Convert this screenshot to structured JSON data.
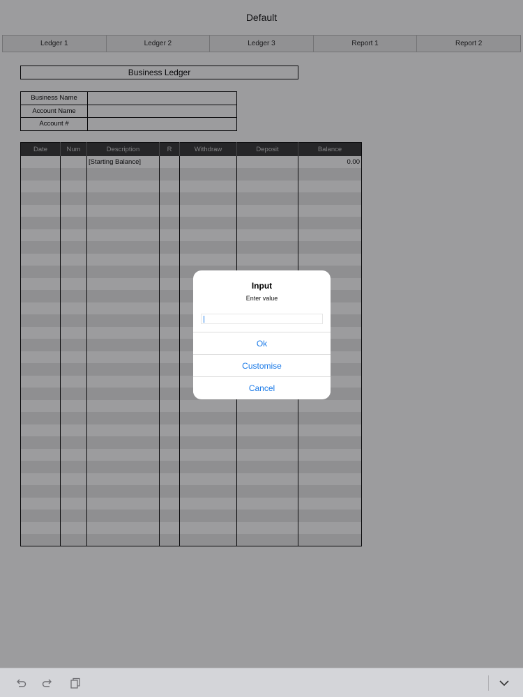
{
  "app": {
    "title": "Default"
  },
  "tabs": [
    {
      "label": "Ledger 1"
    },
    {
      "label": "Ledger 2"
    },
    {
      "label": "Ledger 3"
    },
    {
      "label": "Report 1"
    },
    {
      "label": "Report 2"
    }
  ],
  "sheet": {
    "title": "Business Ledger",
    "info_fields": [
      {
        "label": "Business Name",
        "value": ""
      },
      {
        "label": "Account Name",
        "value": ""
      },
      {
        "label": "Account #",
        "value": ""
      }
    ],
    "ledger": {
      "columns": [
        "Date",
        "Num",
        "Description",
        "R",
        "Withdraw",
        "Deposit",
        "Balance"
      ],
      "first_row": {
        "date": "",
        "num": "",
        "description": "[Starting Balance]",
        "r": "",
        "withdraw": "",
        "deposit": "",
        "balance": "0.00"
      }
    }
  },
  "dialog": {
    "title": "Input",
    "message": "Enter value",
    "input_value": "",
    "buttons": {
      "ok": "Ok",
      "customise": "Customise",
      "cancel": "Cancel"
    }
  },
  "toolbar": {
    "icons": [
      "undo-icon",
      "redo-icon",
      "copy-icon",
      "chevron-down-icon"
    ]
  },
  "colors": {
    "accent": "#1a7ae8",
    "header_bg": "#353535",
    "overlay": "rgba(20,20,24,0.42)"
  }
}
